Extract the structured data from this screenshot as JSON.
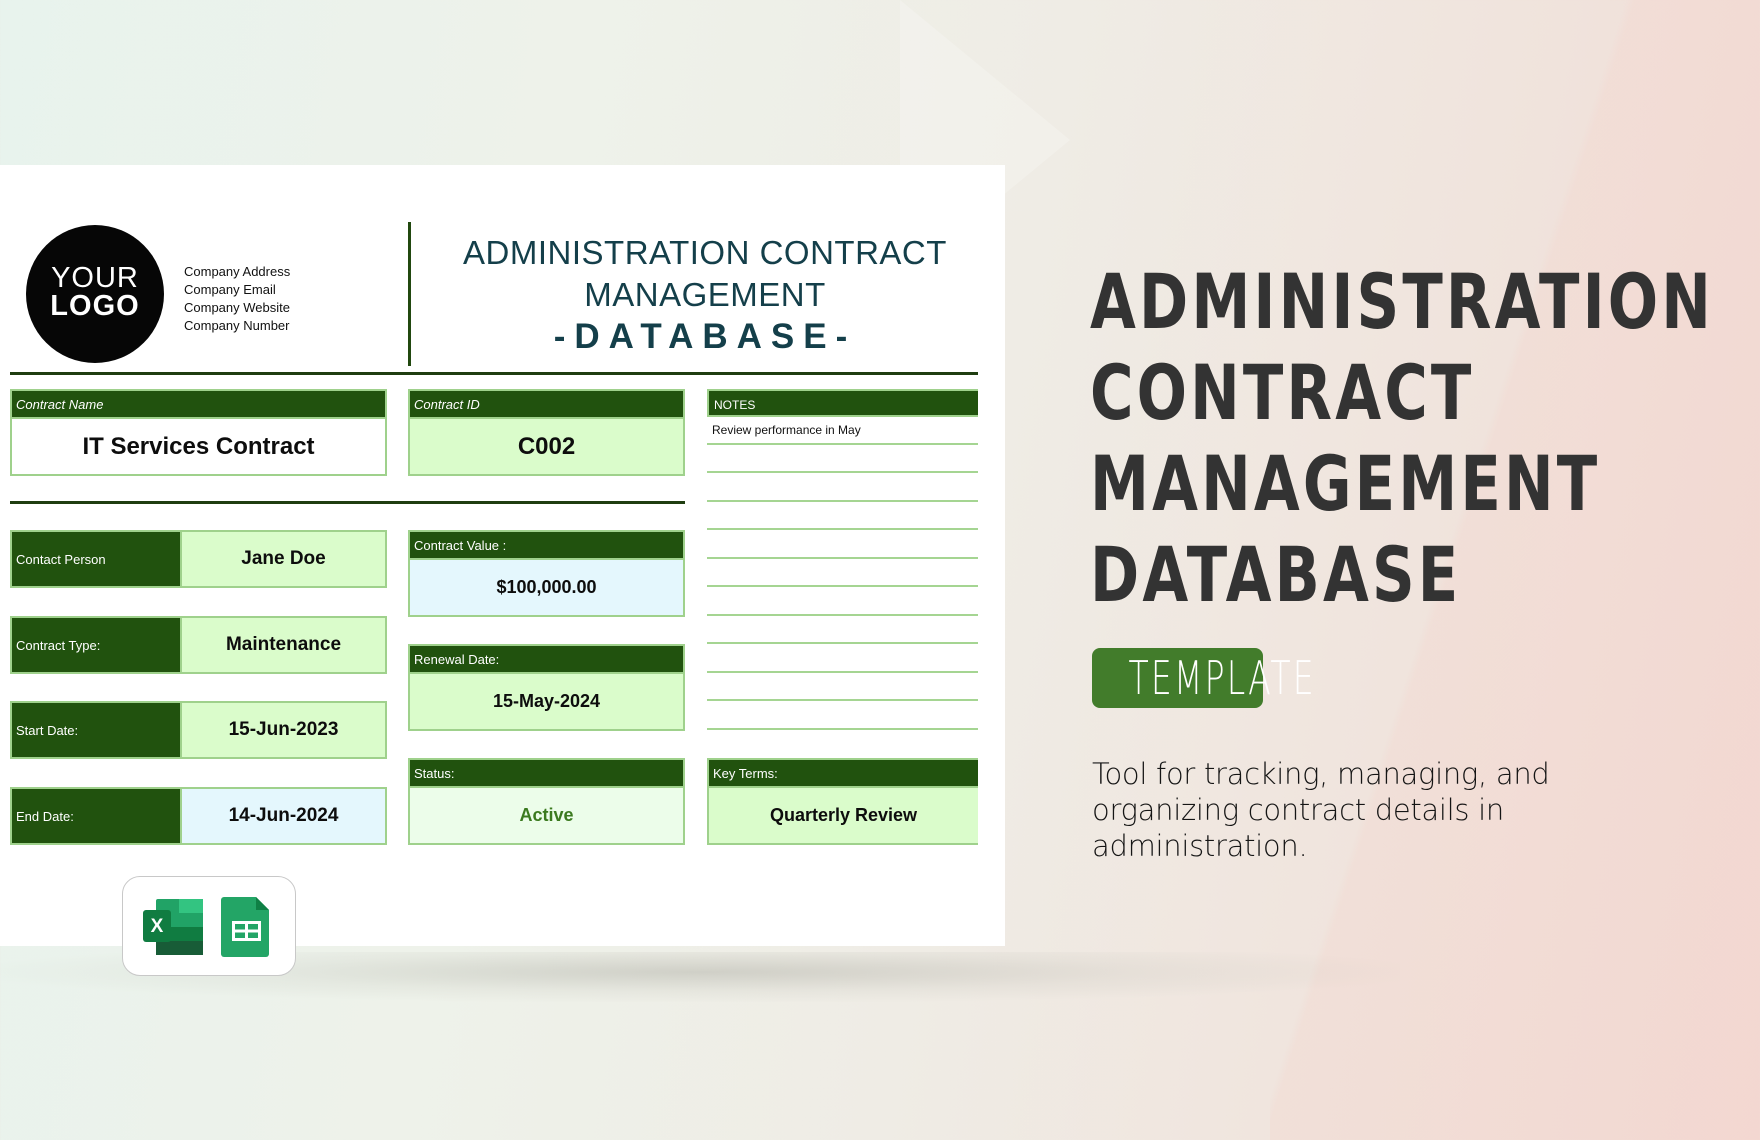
{
  "sheet": {
    "logo": {
      "line1": "YOUR",
      "line2": "LOGO"
    },
    "company_info": [
      "Company Address",
      "Company Email",
      "Company Website",
      "Company Number"
    ],
    "title": {
      "line1": "ADMINISTRATION CONTRACT",
      "line2": "MANAGEMENT",
      "line3": "-DATABASE-"
    },
    "contract_name": {
      "label": "Contract Name",
      "value": "IT Services Contract"
    },
    "contract_id": {
      "label": "Contract ID",
      "value": "C002"
    },
    "notes": {
      "label": "NOTES",
      "lines": [
        "Review performance in May",
        "",
        "",
        "",
        "",
        "",
        "",
        "",
        "",
        "",
        ""
      ]
    },
    "left_fields": [
      {
        "label": "Contact Person",
        "value": "Jane Doe"
      },
      {
        "label": "Contract Type:",
        "value": "Maintenance"
      },
      {
        "label": "Start Date:",
        "value": "15-Jun-2023"
      },
      {
        "label": "End Date:",
        "value": "14-Jun-2024"
      }
    ],
    "contract_value": {
      "label": "Contract Value :",
      "value": "$100,000.00"
    },
    "renewal_date": {
      "label": "Renewal Date:",
      "value": "15-May-2024"
    },
    "status": {
      "label": "Status:",
      "value": "Active"
    },
    "key_terms": {
      "label": "Key Terms:",
      "value": "Quarterly Review"
    },
    "app_icons": [
      "excel-icon",
      "google-sheets-icon"
    ]
  },
  "hero": {
    "title_lines": [
      "ADMINISTRATION",
      "CONTRACT",
      "MANAGEMENT",
      "DATABASE"
    ],
    "badge": "TEMPLATE",
    "description": "Tool for tracking, managing, and organizing contract details in administration."
  },
  "colors": {
    "header_green": "#21520e",
    "border_green": "#9fd18c",
    "value_green": "#dafccb",
    "value_blue": "#e4f7fd",
    "status_text": "#3b7a1f",
    "title_teal": "#143f4a",
    "badge_green": "#427c2b"
  }
}
